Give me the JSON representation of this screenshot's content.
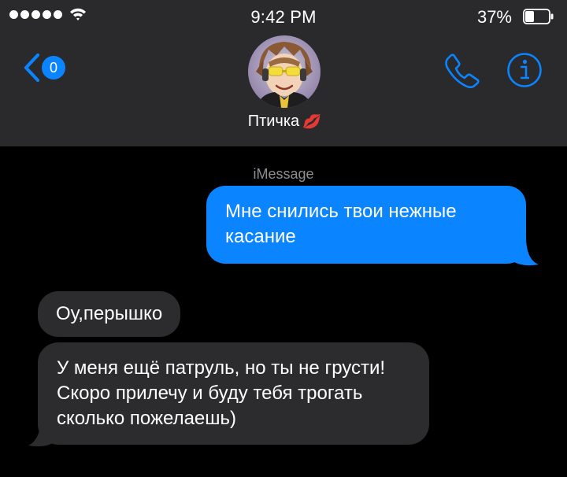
{
  "status_bar": {
    "time": "9:42 PM",
    "battery_percent": "37%",
    "battery_level": 0.37,
    "signal_dots": 5
  },
  "header": {
    "back_count": "0",
    "contact_name": "Птичка",
    "name_emoji_icon": "kiss-lips-icon",
    "accent_color": "#0a84ff"
  },
  "conversation": {
    "service_label": "iMessage",
    "messages": [
      {
        "direction": "sent",
        "text": "Мне снились твои нежные касание"
      },
      {
        "direction": "received",
        "text": "Оу,перышко"
      },
      {
        "direction": "received",
        "text": "У меня ещё патруль, но ты не грусти! Скоро прилечу и буду тебя трогать сколько пожелаешь)"
      }
    ]
  }
}
